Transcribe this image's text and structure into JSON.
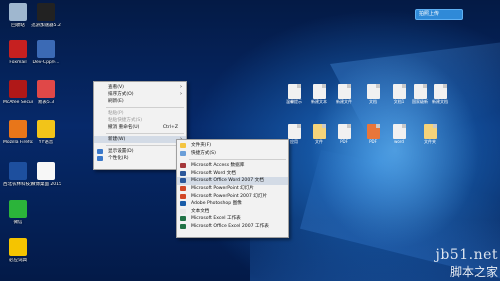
{
  "desktop": {
    "upload_button": "拍照上传",
    "left_icons": [
      {
        "label": "回收站",
        "color": "#9fb7cf"
      },
      {
        "label": "迅游加速器5.2",
        "color": "#222222"
      },
      {
        "label": "Foxmail",
        "color": "#c62020"
      },
      {
        "label": "Dev-Cpp/F...",
        "color": "#3b6ab5"
      },
      {
        "label": "McAfee Security...",
        "color": "#b01818"
      },
      {
        "label": "易表5.3",
        "color": "#e04848"
      },
      {
        "label": "Mozilla Firefox",
        "color": "#e8761a"
      },
      {
        "label": "YY语音",
        "color": "#f2c419"
      },
      {
        "label": "西北农林科技大学...",
        "color": "#1d4f9e"
      },
      {
        "label": "微博桌面 2015",
        "color": "#f7f7f7"
      },
      {
        "label": "微信",
        "color": "#2bb43a"
      },
      {
        "label": "必应词典",
        "color": "#f5c400"
      }
    ],
    "right_icons_row1": [
      {
        "label": "温馨提示",
        "color": "#f1f1f1"
      },
      {
        "label": "新建文本",
        "color": "#f1f1f1"
      },
      {
        "label": "新建文件",
        "color": "#f1f1f1"
      },
      {
        "label": "文档",
        "color": "#f1f1f1"
      },
      {
        "label": "文档1",
        "color": "#f1f1f1"
      },
      {
        "label": "国家级新",
        "color": "#f1f1f1"
      },
      {
        "label": "新建文档",
        "color": "#f1f1f1"
      }
    ],
    "right_icons_row2": [
      {
        "label": "应用",
        "color": "#f1f1f1"
      },
      {
        "label": "文件",
        "color": "#f4d37a"
      },
      {
        "label": "PDF",
        "color": "#f1f1f1"
      },
      {
        "label": "PDF",
        "color": "#e8763a"
      },
      {
        "label": "word",
        "color": "#f1f1f1"
      },
      {
        "label": "文件夹",
        "color": "#f4d37a"
      }
    ]
  },
  "context_menu": {
    "items": [
      {
        "label": "查看(V)",
        "arrow": "›",
        "disabled": false
      },
      {
        "label": "排序方式(O)",
        "arrow": "›",
        "disabled": false
      },
      {
        "label": "刷新(E)",
        "disabled": false
      },
      {
        "separator": true
      },
      {
        "label": "粘贴(P)",
        "disabled": true
      },
      {
        "label": "粘贴快捷方式(S)",
        "disabled": true
      },
      {
        "label": "撤消 重命名(U)",
        "shortcut": "Ctrl+Z",
        "disabled": false
      },
      {
        "separator": true
      },
      {
        "label": "新建(W)",
        "arrow": "›",
        "disabled": false,
        "highlight": true
      },
      {
        "separator": true
      },
      {
        "label": "显示设置(D)",
        "disabled": false,
        "icon_color": "#3a78c9"
      },
      {
        "label": "个性化(R)",
        "disabled": false,
        "icon_color": "#3a78c9"
      }
    ]
  },
  "new_submenu": {
    "items": [
      {
        "label": "文件夹(F)",
        "icon_color": "#f4c542"
      },
      {
        "label": "快捷方式(S)",
        "icon_color": "#6a9ed8"
      },
      {
        "separator": true
      },
      {
        "label": "Microsoft Access 数据库",
        "icon_color": "#a4373a"
      },
      {
        "label": "Microsoft Word 文档",
        "icon_color": "#2b579a"
      },
      {
        "label": "Microsoft Office Word 2007 文档",
        "icon_color": "#2b579a",
        "highlight": true
      },
      {
        "label": "Microsoft PowerPoint 幻灯片",
        "icon_color": "#d24726"
      },
      {
        "label": "Microsoft PowerPoint 2007 幻灯片",
        "icon_color": "#d24726"
      },
      {
        "label": "Adobe Photoshop 图像",
        "icon_color": "#1a5da8"
      },
      {
        "label": "文本文档",
        "icon_color": "#e8e8e8"
      },
      {
        "label": "Microsoft Excel 工作表",
        "icon_color": "#217346"
      },
      {
        "label": "Microsoft Office Excel 2007 工作表",
        "icon_color": "#217346"
      }
    ]
  },
  "watermark": {
    "site": "jb51.net",
    "name": "脚本之家"
  }
}
